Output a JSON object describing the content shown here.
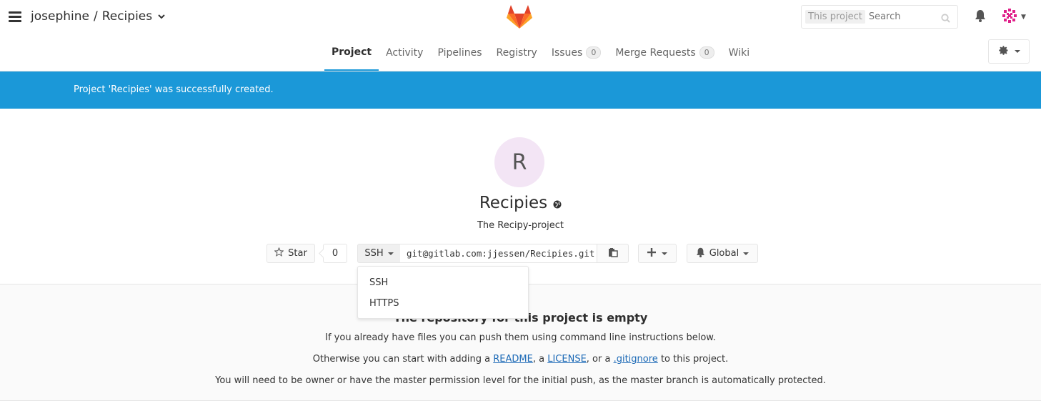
{
  "header": {
    "namespace": "josephine",
    "separator": "/",
    "project": "Recipies",
    "search": {
      "scope": "This project",
      "placeholder": "Search"
    }
  },
  "nav": {
    "tabs": [
      {
        "label": "Project",
        "active": true
      },
      {
        "label": "Activity"
      },
      {
        "label": "Pipelines"
      },
      {
        "label": "Registry"
      },
      {
        "label": "Issues",
        "badge": "0"
      },
      {
        "label": "Merge Requests",
        "badge": "0"
      },
      {
        "label": "Wiki"
      }
    ]
  },
  "flash": {
    "message": "Project 'Recipies' was successfully created.",
    "color": "#1b98d8"
  },
  "project": {
    "avatar_letter": "R",
    "title": "Recipies",
    "description": "The Recipy-project",
    "star_label": "Star",
    "star_count": "0",
    "clone_protocol": "SSH",
    "clone_url": "git@gitlab.com:jjessen/Recipies.git",
    "notification_label": "Global"
  },
  "dropdown": {
    "options": [
      "SSH",
      "HTTPS"
    ]
  },
  "empty": {
    "title": "The repository for this project is empty",
    "line1": "If you already have files you can push them using command line instructions below.",
    "line2_prefix": "Otherwise you can start with adding a ",
    "readme": "README",
    "comma_a": ", a ",
    "license": "LICENSE",
    "or_a": ", or a ",
    "gitignore": ".gitignore",
    "line2_suffix": " to this project.",
    "line3": "You will need to be owner or have the master permission level for the initial push, as the master branch is automatically protected."
  },
  "icons": {
    "menu": "hamburger-icon",
    "logo": "gitlab-logo",
    "search": "search-icon",
    "bell": "bell-icon",
    "settings": "gear-icon",
    "star": "star-icon",
    "copy": "clipboard-icon",
    "plus": "plus-icon",
    "globe": "globe-icon"
  }
}
